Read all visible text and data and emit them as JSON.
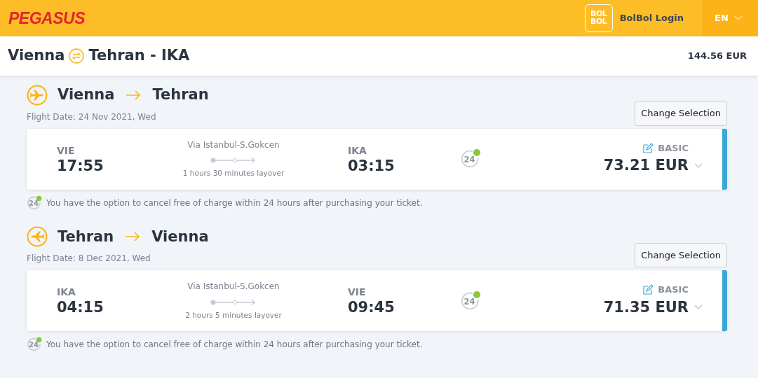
{
  "header": {
    "logo": "PEGASUS",
    "bolbol_logo": [
      "BOL",
      "BOL"
    ],
    "login": "BolBol Login",
    "language": "EN"
  },
  "summary": {
    "from": "Vienna",
    "to": "Tehran - IKA",
    "total": "144.56 EUR"
  },
  "flights": [
    {
      "kind": "outbound",
      "from": "Vienna",
      "to": "Tehran",
      "date": "Flight Date: 24 Nov 2021, Wed",
      "change": "Change Selection",
      "dep_code": "VIE",
      "dep_time": "17:55",
      "via": "Via Istanbul-S.Gokcen",
      "layover": "1 hours 30 minutes layover",
      "arr_code": "IKA",
      "arr_time": "03:15",
      "flex_badge": "24",
      "fare": "BASIC",
      "price": "73.21 EUR",
      "note_badge": "24",
      "note": "You have the option to cancel free of charge within 24 hours after purchasing your ticket."
    },
    {
      "kind": "return",
      "from": "Tehran",
      "to": "Vienna",
      "date": "Flight Date: 8 Dec 2021, Wed",
      "change": "Change Selection",
      "dep_code": "IKA",
      "dep_time": "04:15",
      "via": "Via Istanbul-S.Gokcen",
      "layover": "2 hours 5 minutes layover",
      "arr_code": "VIE",
      "arr_time": "09:45",
      "flex_badge": "24",
      "fare": "BASIC",
      "price": "71.35 EUR",
      "note_badge": "24",
      "note": "You have the option to cancel free of charge within 24 hours after purchasing your ticket."
    }
  ]
}
